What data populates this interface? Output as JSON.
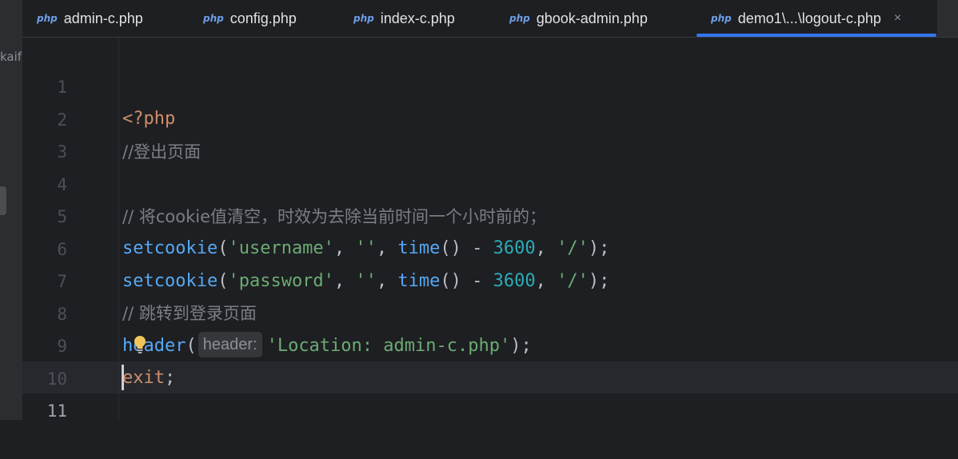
{
  "left_panel": {
    "label": "kaif"
  },
  "tabs": [
    {
      "icon": "php-file-icon",
      "icon_text": "php",
      "label": "admin-c.php"
    },
    {
      "icon": "php-file-icon",
      "icon_text": "php",
      "label": "config.php"
    },
    {
      "icon": "php-file-icon",
      "icon_text": "php",
      "label": "index-c.php"
    },
    {
      "icon": "php-file-icon",
      "icon_text": "php",
      "label": "gbook-admin.php"
    },
    {
      "icon": "php-file-icon",
      "icon_text": "php",
      "label": "demo1\\...\\logout-c.php",
      "active": true,
      "close": "×"
    }
  ],
  "editor": {
    "line_numbers": [
      "1",
      "2",
      "3",
      "4",
      "5",
      "6",
      "7",
      "8",
      "9",
      "10",
      "11"
    ],
    "current_line": 11,
    "lines": {
      "l1": {
        "open_tag": "<?php"
      },
      "l2": {
        "comment": "//登出页面"
      },
      "l4": {
        "comment": "// 将cookie值清空，时效为去除当前时间一个小时前的；"
      },
      "l5": {
        "fn": "setcookie",
        "p1": "(",
        "s1": "'username'",
        "p2": ", ",
        "s2": "''",
        "p3": ", ",
        "fn2": "time",
        "p4": "() - ",
        "n": "3600",
        "p5": ", ",
        "s3": "'/'",
        "p6": ");"
      },
      "l6": {
        "fn": "setcookie",
        "p1": "(",
        "s1": "'password'",
        "p2": ", ",
        "s2": "''",
        "p3": ", ",
        "fn2": "time",
        "p4": "() - ",
        "n": "3600",
        "p5": ", ",
        "s3": "'/'",
        "p6": ");"
      },
      "l7": {
        "comment": "// 跳转到登录页面"
      },
      "l8": {
        "fn": "header",
        "p1": "(",
        "hint": "header:",
        "s1": "'Location: admin-c.php'",
        "p2": ");"
      },
      "l9": {
        "kw": "exit",
        "p1": ";"
      }
    }
  },
  "colors": {
    "background": "#1e1f22",
    "accent": "#3574f0",
    "keyword": "#cf8e6d",
    "comment": "#7a7e85",
    "function": "#56a8f5",
    "string": "#6aab73",
    "number": "#2aacb8"
  },
  "icons": {
    "intention": "lightbulb-icon"
  }
}
